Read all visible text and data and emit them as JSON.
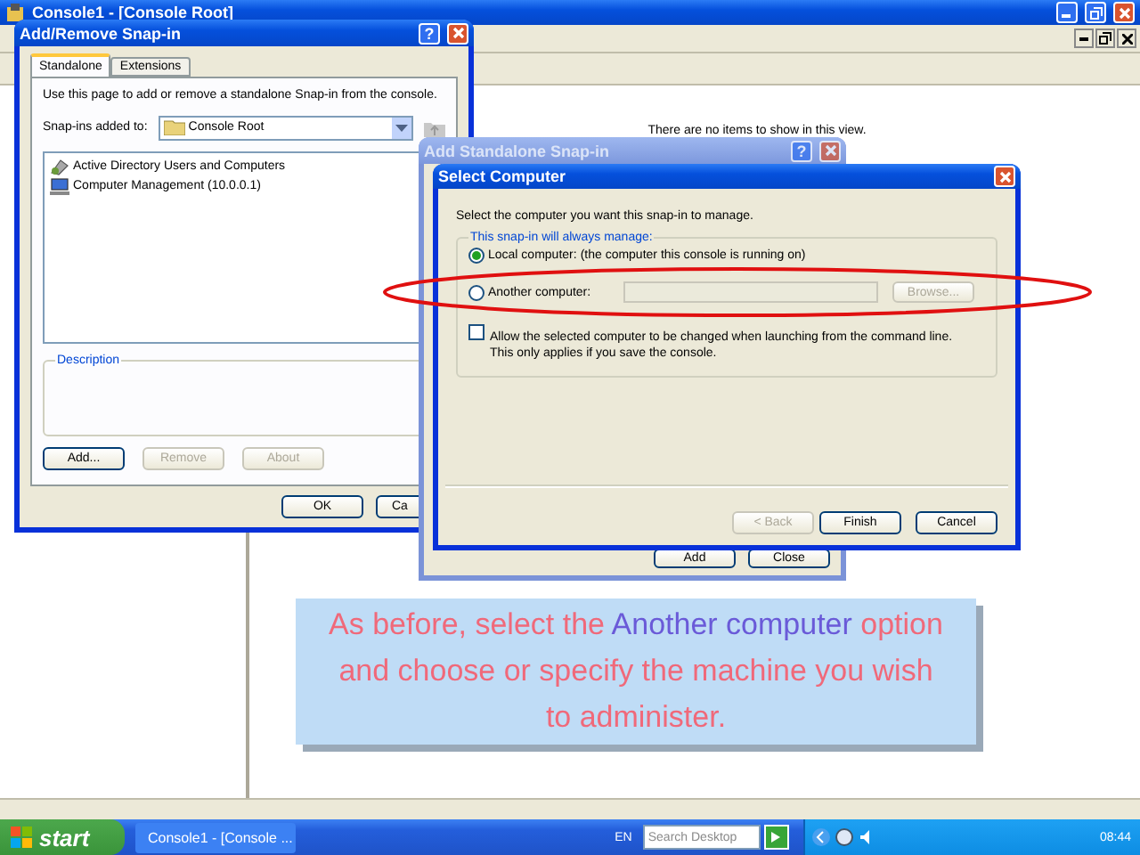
{
  "main_window": {
    "title": "Console1 - [Console Root]",
    "message": "There are no items to show in this view."
  },
  "add_remove_dialog": {
    "title": "Add/Remove Snap-in",
    "help": "?",
    "tabs": [
      {
        "label": "Standalone",
        "selected": true
      },
      {
        "label": "Extensions",
        "selected": false
      }
    ],
    "intro": "Use this page to add or remove a standalone Snap-in from the console.",
    "added_to_label": "Snap-ins added to:",
    "added_to_value": "Console Root",
    "snapins": [
      {
        "name": "Active Directory Users and Computers",
        "kind": "directory"
      },
      {
        "name": "Computer Management (10.0.0.1)",
        "kind": "computer"
      }
    ],
    "description_label": "Description",
    "buttons": [
      {
        "label": "Add...",
        "disabled": false
      },
      {
        "label": "Remove",
        "disabled": true
      },
      {
        "label": "About",
        "disabled": true
      }
    ],
    "footer_buttons": [
      "OK",
      "Ca"
    ]
  },
  "add_standalone_dialog": {
    "title": "Add Standalone Snap-in",
    "help": "?",
    "buttons": [
      "Add",
      "Close"
    ]
  },
  "select_computer_dialog": {
    "title": "Select Computer",
    "intro": "Select the computer you want this snap-in to manage.",
    "group_label": "This snap-in will always manage:",
    "options": [
      {
        "label": "Local computer:",
        "note": "(the computer this console is running on)",
        "selected": true
      },
      {
        "label": "Another computer:",
        "selected": false
      }
    ],
    "browse_button": "Browse...",
    "allow_change": {
      "label": "Allow the selected computer to be changed when launching from the command line. This only applies if you save the console.",
      "checked": false
    },
    "buttons": [
      {
        "label": "< Back",
        "disabled": true
      },
      {
        "label": "Finish",
        "disabled": false
      },
      {
        "label": "Cancel",
        "disabled": false
      }
    ]
  },
  "caption": {
    "segments": [
      {
        "text": "As before, select the ",
        "highlight": false
      },
      {
        "text": "Another computer",
        "highlight": true
      },
      {
        "text": " option and choose or specify the machine you wish to administer.",
        "highlight": false
      }
    ]
  },
  "taskbar": {
    "start": "start",
    "tasks": [
      {
        "label": "Console1 - [Console ...",
        "selected": false
      }
    ],
    "language": "EN",
    "search": {
      "placeholder": "Search Desktop"
    },
    "clock": "08:44"
  }
}
